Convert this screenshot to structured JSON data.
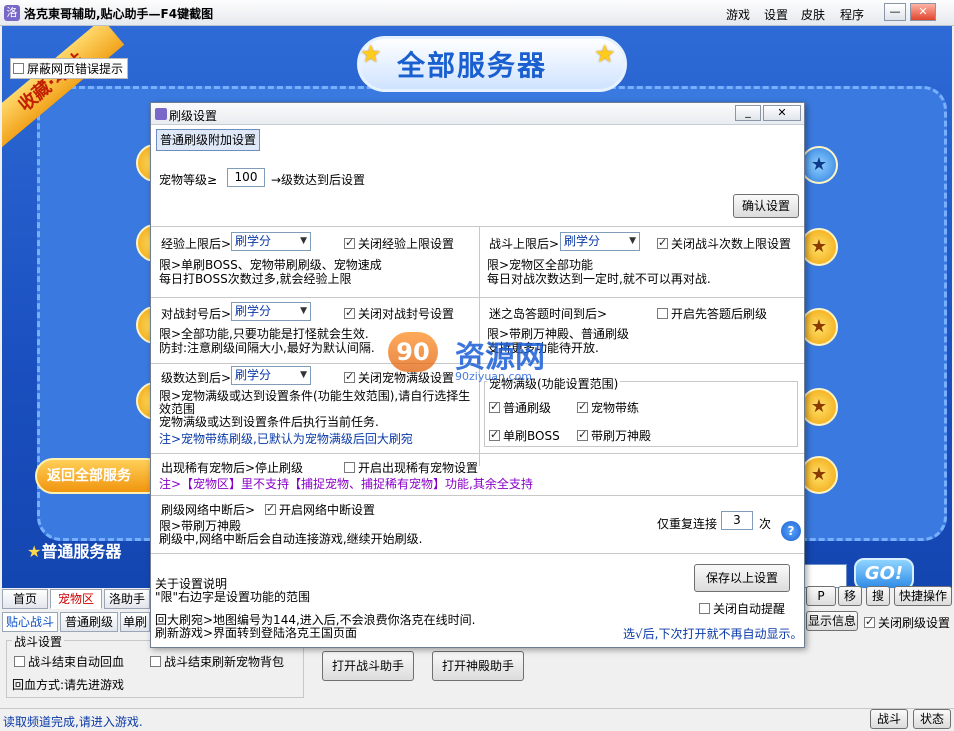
{
  "window": {
    "title": "洛克東哥辅助,贴心助手—F4键截图",
    "menu": [
      "游戏",
      "设置",
      "皮肤",
      "程序"
    ],
    "minimize": "—",
    "close": "✕"
  },
  "game": {
    "banner": "全部服务器",
    "ribbon": "收藏·本站",
    "screen_error": "屏蔽网页错误提示",
    "back_button": "返回全部服务",
    "normal_server": "普通服务器",
    "go": "GO!"
  },
  "bottom": {
    "tabs_row1": [
      "首页",
      "宠物区",
      "洛助手"
    ],
    "tabs_row2": [
      "贴心战斗",
      "普通刷级",
      "单刷"
    ],
    "right_buttons": [
      "P",
      "移",
      "搜",
      "快捷操作"
    ],
    "show_info": "显示信息",
    "close_level_setting": "关闭刷级设置",
    "battle_group_label": "战斗设置",
    "auto_heal": "战斗结束自动回血",
    "refresh_pet_bag": "战斗结束刷新宠物背包",
    "heal_method": "回血方式:请先进游戏",
    "open_battle_helper": "打开战斗助手",
    "open_divine_helper": "打开神殿助手",
    "status_text": "读取频道完成,请进入游戏.",
    "status_buttons": [
      "战斗",
      "状态"
    ]
  },
  "dialog": {
    "title": "刷级设置",
    "min_label": "_",
    "close_label": "✕",
    "tab": "普通刷级附加设置",
    "pet_level_label": "宠物等级≥",
    "pet_level_value": "100",
    "pet_level_suffix": "→级数达到后设置",
    "confirm_button": "确认设置",
    "exp_limit": {
      "label": "经验上限后>",
      "select": "刷学分",
      "checkbox": "关闭经验上限设置",
      "desc": [
        "限>单刷BOSS、宠物带刷刷级、宠物速成",
        "每日打BOSS次数过多,就会经验上限"
      ]
    },
    "battle_limit": {
      "label": "战斗上限后>",
      "select": "刷学分",
      "checkbox": "关闭战斗次数上限设置",
      "desc": [
        "限>宠物区全部功能",
        "每日对战次数达到一定时,就不可以再对战."
      ]
    },
    "ban": {
      "label": "对战封号后>",
      "select": "刷学分",
      "checkbox": "关闭对战封号设置",
      "desc": [
        "限>全部功能,只要功能是打怪就会生效.",
        "防封:注意刷级间隔大小,最好为默认间隔."
      ]
    },
    "maze": {
      "label": "迷之岛答题时间到后>",
      "checkbox": "开启先答题后刷级",
      "desc": [
        "限>带刷万神殿、普通刷级",
        "支持更多功能待开放."
      ]
    },
    "level_reach": {
      "label": "级数达到后>",
      "select": "刷学分",
      "checkbox": "关闭宠物满级设置",
      "desc": [
        "限>宠物满级或达到设置条件(功能生效范围),请自行选择生",
        "效范围",
        "宠物满级或达到设置条件后执行当前任务."
      ],
      "note": "注>宠物带练刷级,已默认为宠物满级后回大刷宛"
    },
    "pet_full": {
      "title": "宠物满级(功能设置范围)",
      "items": [
        "普通刷级",
        "宠物带练",
        "单刷BOSS",
        "带刷万神殿"
      ]
    },
    "rare": {
      "label": "出现稀有宠物后>停止刷级",
      "checkbox": "开启出现稀有宠物设置",
      "note": "注>【宠物区】里不支持【捕捉宠物、捕捉稀有宠物】功能,其余全支持"
    },
    "net": {
      "label": "刷级网络中断后>",
      "checkbox": "开启网络中断设置",
      "desc": [
        "限>带刷万神殿",
        "刷级中,网络中断后会自动连接游戏,继续开始刷级."
      ],
      "retry_label": "仅重复连接",
      "retry_value": "3",
      "retry_suffix": "次",
      "help": "?"
    },
    "about": {
      "lines": [
        "关于设置说明",
        "\"限\"右边字是设置功能的范围",
        "",
        "回大刷宛>地图编号为144,进入后,不会浪费你洛克在线时间.",
        "刷新游戏>界面转到登陆洛克王国页面"
      ]
    },
    "save_button": "保存以上设置",
    "close_auto_tip": "关闭自动提醒",
    "tip_note": "选√后,下次打开就不再自动显示。"
  },
  "watermark": {
    "text": "资源网",
    "sub": "90ziyuan.com"
  }
}
